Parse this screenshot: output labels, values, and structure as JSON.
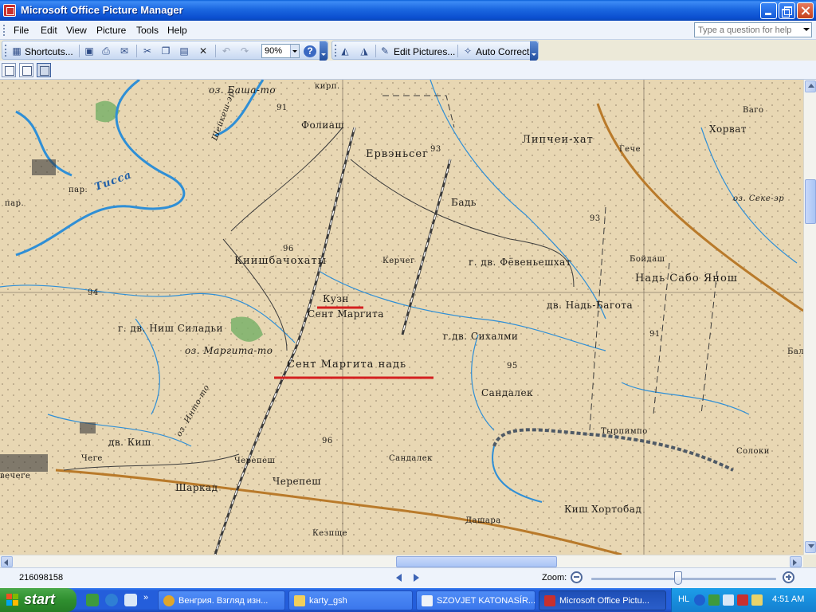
{
  "window": {
    "title": "Microsoft Office Picture Manager",
    "help_placeholder": "Type a question for help"
  },
  "menu": {
    "items": [
      "File",
      "Edit",
      "View",
      "Picture",
      "Tools",
      "Help"
    ]
  },
  "toolbar": {
    "shortcuts_label": "Shortcuts...",
    "zoom_value": "90%",
    "edit_pictures_label": "Edit Pictures...",
    "auto_correct_label": "Auto Correct"
  },
  "map": {
    "labels": {
      "l1": "оз. Баша-то",
      "l2": "кирп.",
      "l3": "Фолиаш",
      "l4": "Ервэньсег",
      "l5": "Липчеи-хат",
      "l6": "Хорват",
      "l7": "Ваго",
      "l8": "Гече",
      "l9": "Бадь",
      "l10": "Тисса",
      "l11": "пар.",
      "l12": "пар.",
      "l13": "Киишбачохаты",
      "l14": "Керчег",
      "l15": "г. дв. Фёвеньешхат",
      "l16": "Бойдаш",
      "l17": "Надь Сабо Янош",
      "l18": "оз. Секе-эр",
      "l19": "Кузн",
      "l20": "Сент Маргита",
      "l21": "дв. Надь-Багота",
      "l22": "г. дв. Ниш Силадьи",
      "l23": "г.дв. Сихалми",
      "l24": "оз. Маргита-то",
      "l25": "Сент Маргита надь",
      "l26": "Сандалек",
      "l27": "оз. Инто-то",
      "l28": "дв. Киш",
      "l29": "Чеге",
      "l30": "Черепеш",
      "l31": "Черепеш",
      "l32": "Шаркад",
      "l33": "Сандалек",
      "l34": "Тырпимпо",
      "l35": "Солоки",
      "l36": "Киш Хортобад",
      "l37": "Дашара",
      "l38": "Кезпще",
      "l39": "вечеге",
      "l40": "Шейкеш-эр",
      "l41": "Бал"
    },
    "heights": [
      "91",
      "93",
      "94",
      "96",
      "96",
      "91",
      "93",
      "95"
    ],
    "colors": {
      "paper": "#e8d7b3",
      "water": "#2f8fd6",
      "road": "#b97a2a",
      "rail": "#3b3b3b",
      "forest": "#7ab26a",
      "marker": "#d42020"
    }
  },
  "status": {
    "filename": "216098158",
    "zoom_label": "Zoom:",
    "zoom_level": 0.47
  },
  "taskbar": {
    "start_label": "start",
    "buttons": [
      "Венгрия. Взгляд изн...",
      "karty_gsh",
      "SZOVJET KATONASÍR...",
      "Microsoft Office Pictu..."
    ],
    "language": "HL",
    "clock": "4:51 AM"
  }
}
